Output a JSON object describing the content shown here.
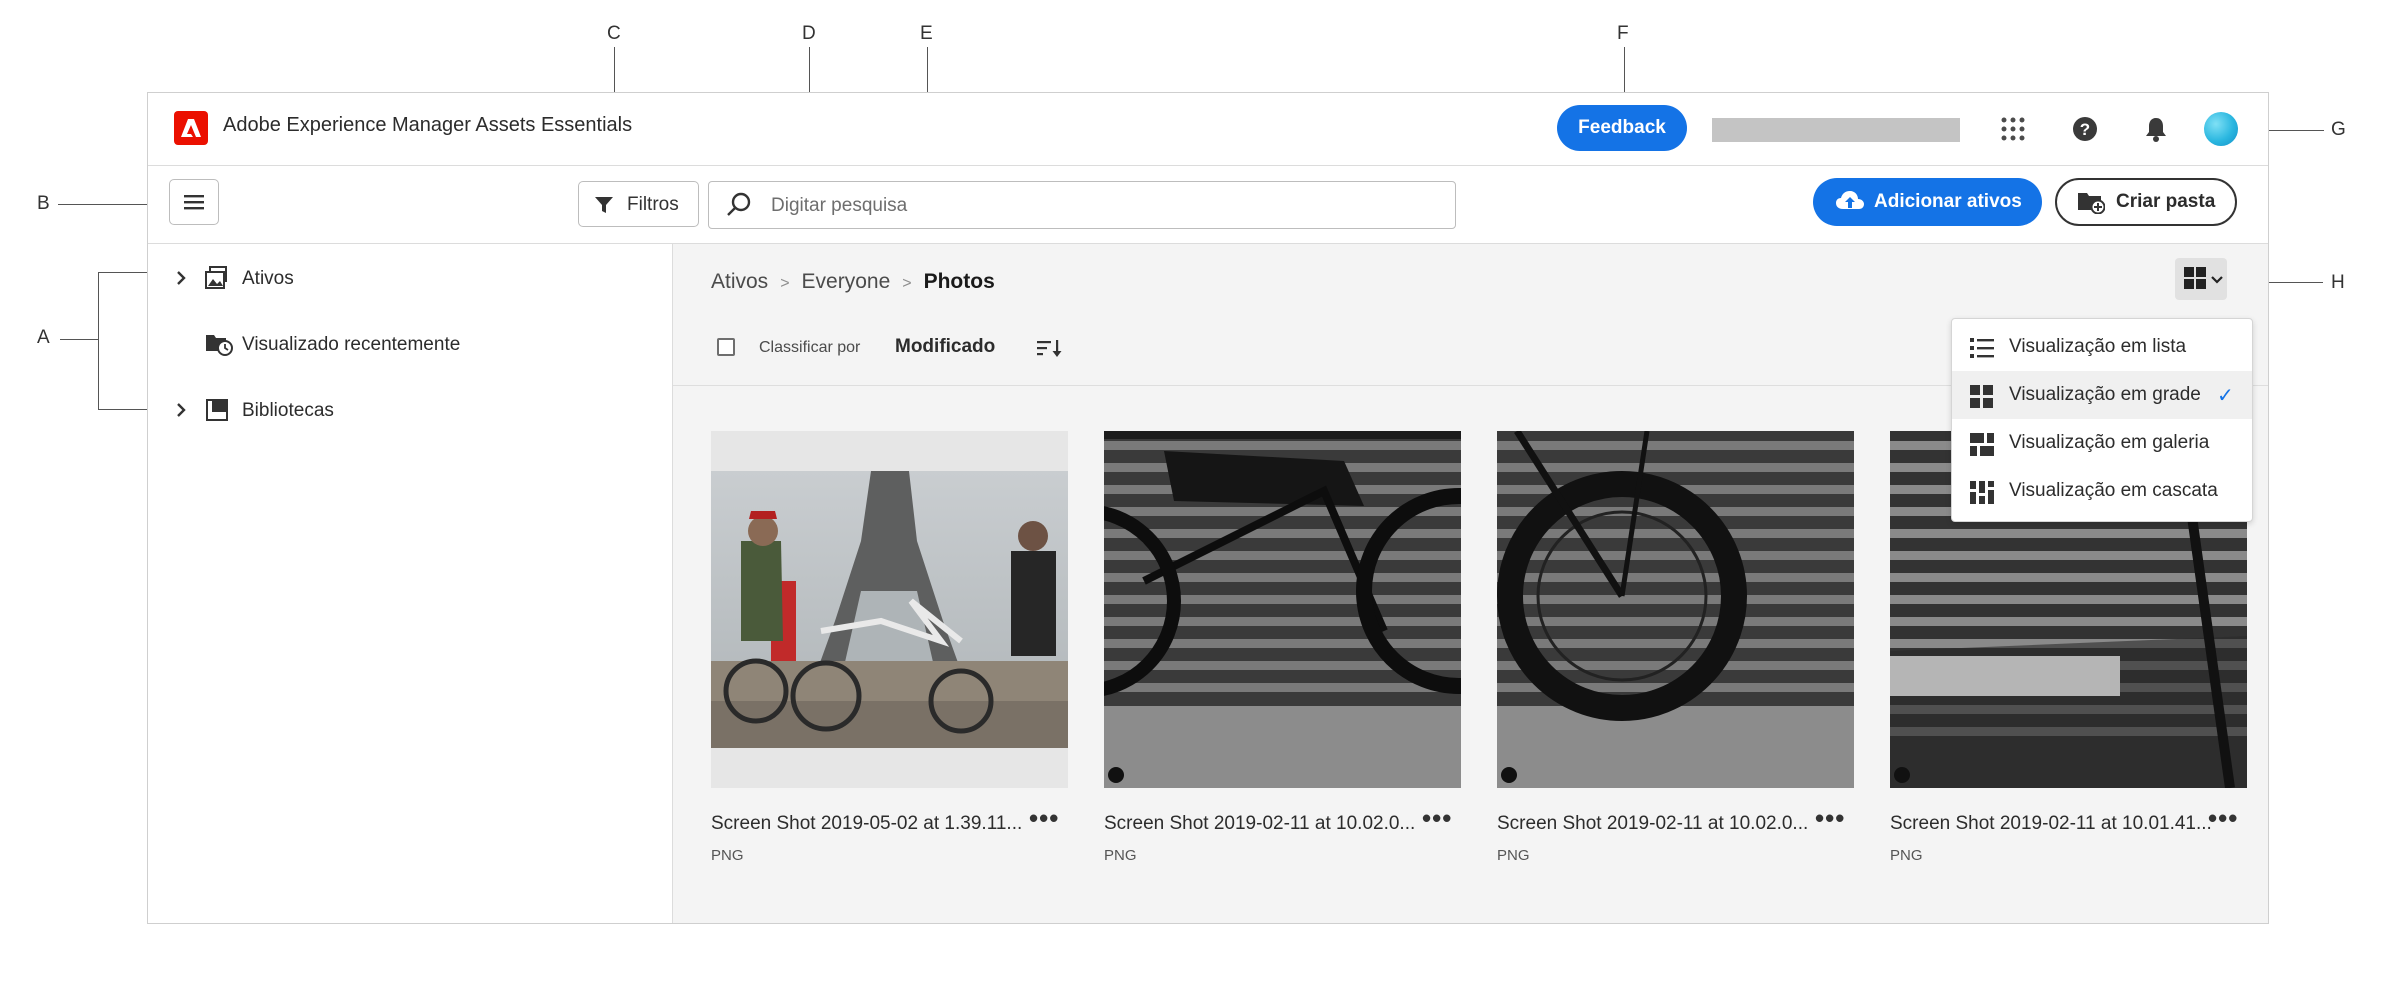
{
  "callouts": {
    "a": "A",
    "b": "B",
    "c": "C",
    "d": "D",
    "e": "E",
    "f": "F",
    "g": "G",
    "h": "H"
  },
  "header": {
    "app_title": "Adobe Experience Manager Assets Essentials",
    "feedback_label": "Feedback",
    "icons": [
      "app-switcher-icon",
      "help-icon",
      "notifications-icon"
    ],
    "brand_color": "#1473e6"
  },
  "toolbar": {
    "filters_label": "Filtros",
    "search_placeholder": "Digitar pesquisa",
    "add_assets_label": "Adicionar ativos",
    "create_folder_label": "Criar pasta"
  },
  "sidebar": {
    "items": [
      {
        "label": "Ativos",
        "icon": "assets-icon",
        "expandable": true
      },
      {
        "label": "Visualizado recentemente",
        "icon": "recent-icon",
        "expandable": false
      },
      {
        "label": "Bibliotecas",
        "icon": "libraries-icon",
        "expandable": true
      }
    ]
  },
  "breadcrumb": {
    "items": [
      "Ativos",
      "Everyone"
    ],
    "current": "Photos"
  },
  "sort": {
    "label": "Classificar por",
    "value": "Modificado"
  },
  "assets": [
    {
      "name": "Screen Shot 2019-05-02 at 1.39.11...",
      "type": "PNG"
    },
    {
      "name": "Screen Shot 2019-02-11 at 10.02.0...",
      "type": "PNG"
    },
    {
      "name": "Screen Shot 2019-02-11 at 10.02.0...",
      "type": "PNG"
    },
    {
      "name": "Screen Shot 2019-02-11 at 10.01.41...",
      "type": "PNG"
    }
  ],
  "more_label": "•••",
  "view_menu": {
    "items": [
      {
        "label": "Visualização em lista",
        "selected": false
      },
      {
        "label": "Visualização em grade",
        "selected": true
      },
      {
        "label": "Visualização em galeria",
        "selected": false
      },
      {
        "label": "Visualização em cascata",
        "selected": false
      }
    ],
    "check": "✓"
  }
}
